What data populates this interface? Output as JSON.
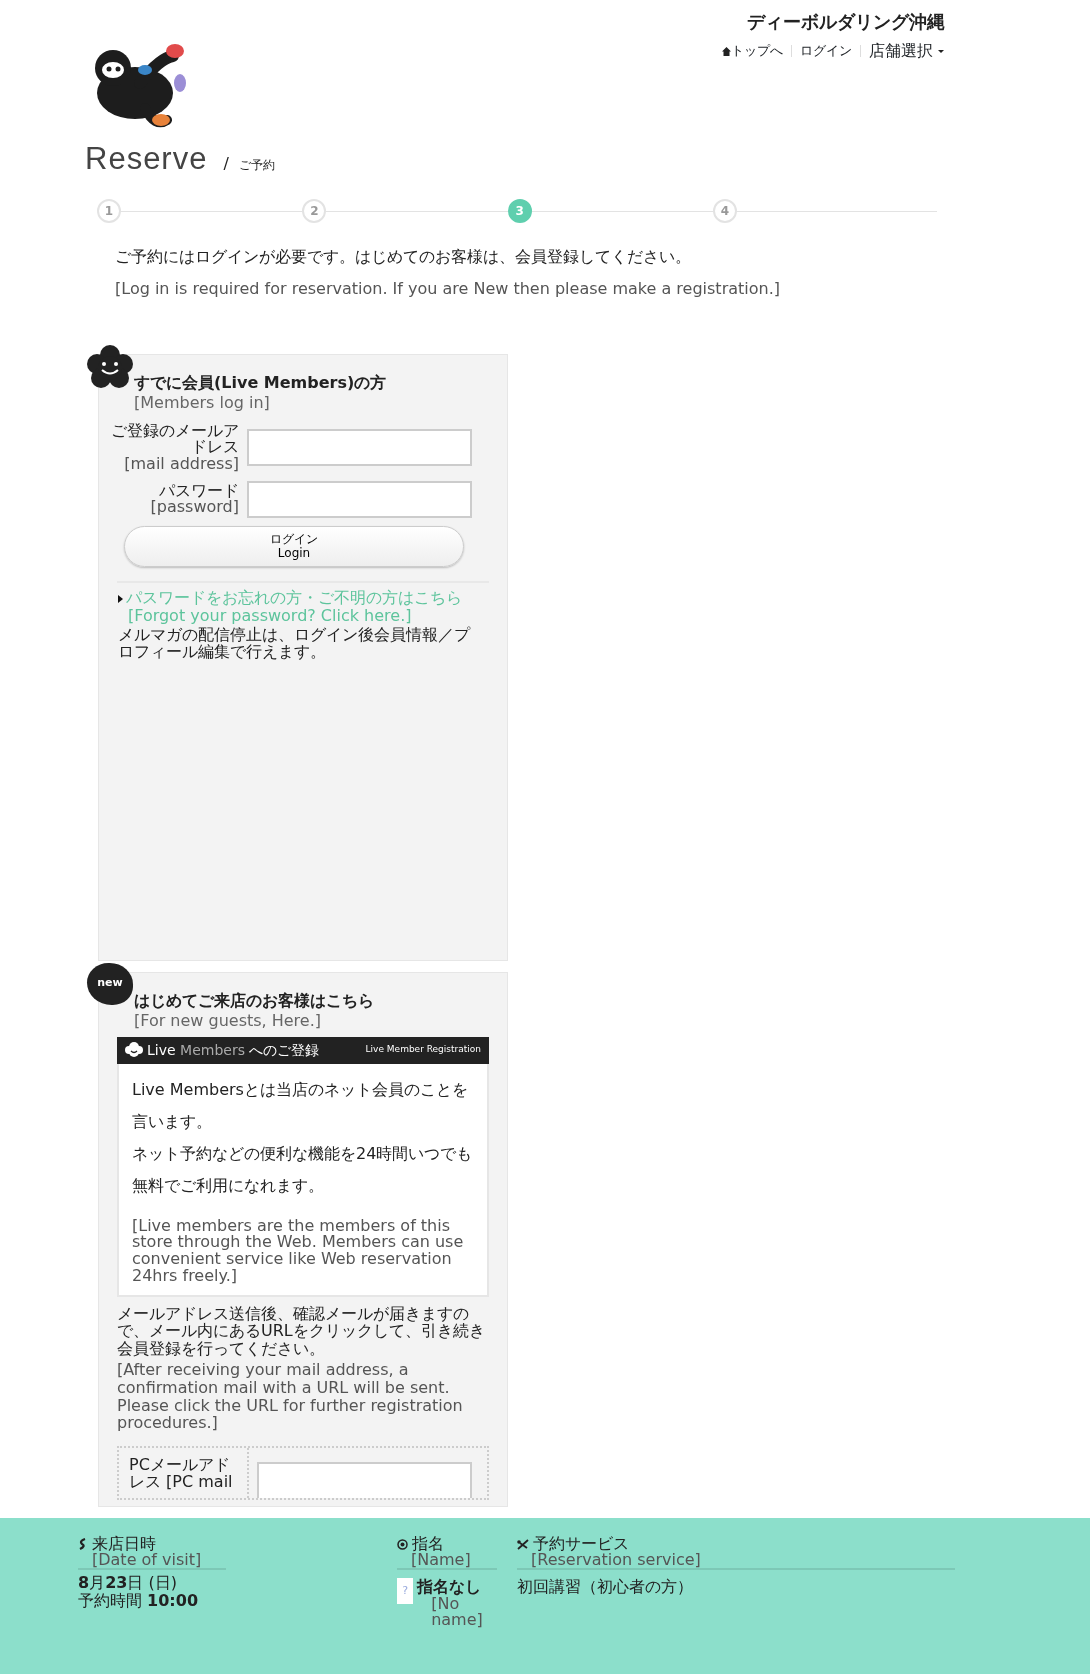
{
  "header": {
    "site_title": "ディーボルダリング沖縄",
    "nav": [
      {
        "kind": "home",
        "label": "トップへ"
      },
      {
        "kind": "link",
        "label": "ログイン"
      }
    ],
    "store_select": "店舗選択"
  },
  "page_title": {
    "main": "Reserve",
    "separator": "/",
    "sub": "ご予約"
  },
  "steps": [
    {
      "label": "1",
      "selected": false
    },
    {
      "label": "2",
      "selected": false
    },
    {
      "label": "3",
      "selected": true
    },
    {
      "label": "4",
      "selected": false
    }
  ],
  "notice": {
    "ja": "ご予約にはログインが必要です。はじめてのお客様は、会員登録してください。",
    "en": "[Log in is required for reservation. If you are New then please make a registration.]"
  },
  "login": {
    "title": "すでに会員(Live Members)の方",
    "subtitle": "[Members log in]",
    "fields": [
      {
        "label_ja": "ご登録のメールアドレス",
        "label_en": "[mail address]"
      },
      {
        "label_ja": "パスワード",
        "label_en": "[password]"
      }
    ],
    "button": {
      "label": "ログイン",
      "sublabel": "Login"
    },
    "forgot": {
      "ja": "パスワードをお忘れの方・ご不明の方はこちら",
      "en": "[Forgot your password? Click here.]"
    },
    "note": "メルマガの配信停止は、ログイン後会員情報／プロフィール編集で行えます。"
  },
  "register": {
    "badge": "new",
    "title": "はじめてご来店のお客様はこちら",
    "subtitle": "[For new guests, Here.]",
    "banner": {
      "live": "Live",
      "members": "Members",
      "suffix": "へのご登録",
      "english": "Live Member Registration"
    },
    "intro_ja": [
      "Live Membersとは当店のネット会員のことを言います。",
      "ネット予約などの便利な機能を24時間いつでも無料でご利用になれます。"
    ],
    "intro_en": "[Live members are the members of this store through the Web. Members can use convenient service like Web reservation 24hrs freely.]",
    "instructions_ja": "メールアドレス送信後、確認メールが届きますので、メール内にあるURLをクリックして、引き続き会員登録を行ってください。",
    "instructions_en": "[After receiving your mail address, a confirmation mail with a URL will be sent. Please click the URL for further registration procedures.]",
    "pc_mail_label": "PCメールアドレス [PC mail"
  },
  "summary": {
    "date": {
      "title": "来店日時",
      "subtitle": "[Date of visit]",
      "date_line": "**8**月**23**日 (日)",
      "time_line": "予約時間 **10:00**"
    },
    "staff": {
      "title": "指名",
      "subtitle": "[Name]",
      "avatar_mark": "?",
      "value": "指名なし",
      "value_en": "[No name]"
    },
    "service": {
      "title": "予約サービス",
      "subtitle": "[Reservation service]",
      "value": "初回講習（初心者の方）"
    }
  }
}
